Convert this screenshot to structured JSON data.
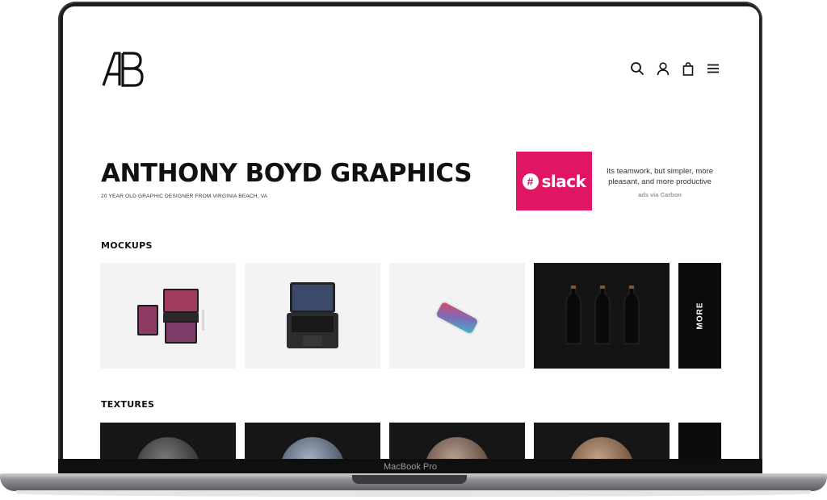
{
  "device": {
    "model_label": "MacBook Pro"
  },
  "header": {
    "logo_text": "AB",
    "icons": [
      "search-icon",
      "user-icon",
      "bag-icon",
      "menu-icon"
    ]
  },
  "hero": {
    "title": "ANTHONY BOYD GRAPHICS",
    "subtitle": "20 YEAR OLD GRAPHIC DESIGNER FROM VIRGINIA BEACH, VA"
  },
  "ad": {
    "brand": "slack",
    "brand_mark": "#",
    "text": "Its teamwork, but simpler, more pleasant, and more productive",
    "via": "ads via Carbon",
    "color": "#e01563"
  },
  "mockups": {
    "title": "MOCKUPS",
    "more_label": "MORE",
    "items": [
      "ipad-mockup",
      "macbook-mockup",
      "iphone-mockup",
      "bottle-mockup"
    ]
  },
  "textures": {
    "title": "TEXTURES",
    "items": [
      "dark-speckled-texture",
      "blue-grey-stone-texture",
      "wood-texture",
      "light-wood-texture"
    ]
  }
}
